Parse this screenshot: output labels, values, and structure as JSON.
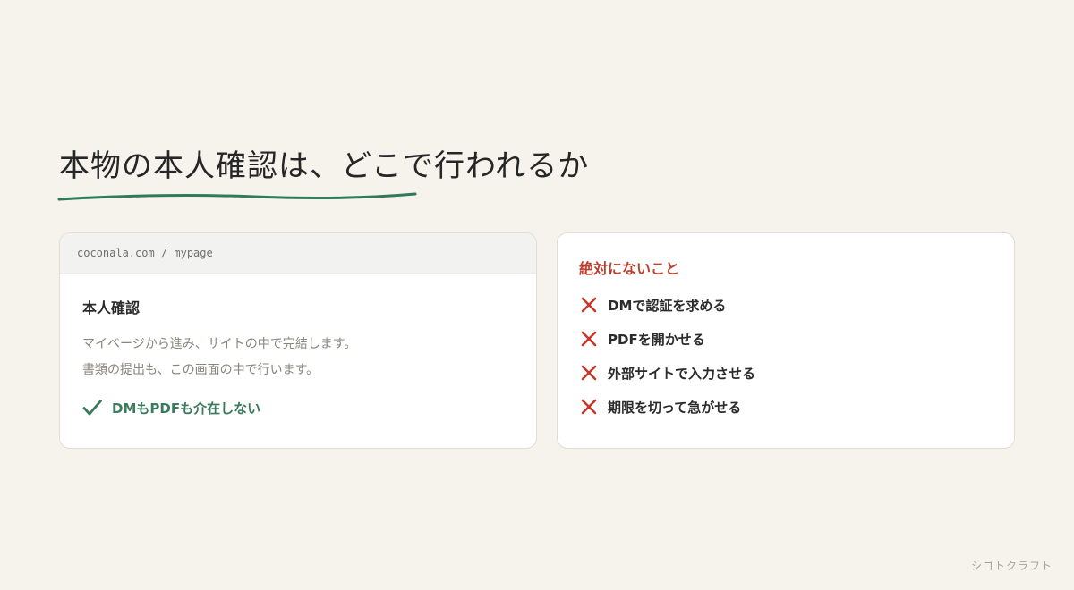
{
  "heading": {
    "title": "本物の本人確認は、どこで行われるか"
  },
  "legit_card": {
    "url": "coconala.com / mypage",
    "title": "本人確認",
    "lines": [
      "マイページから進み、サイトの中で完結します。",
      "書類の提出も、この画面の中で行います。"
    ],
    "check_text": "DMもPDFも介在しない",
    "check_icon": "check-icon"
  },
  "never_card": {
    "title": "絶対にないこと",
    "items": [
      "DMで認証を求める",
      "PDFを開かせる",
      "外部サイトで入力させる",
      "期限を切って急がせる"
    ],
    "item_icon": "cross-icon"
  },
  "watermark": "シゴトクラフト",
  "colors": {
    "background": "#f6f3ed",
    "accent_green": "#3a7a5e",
    "accent_red": "#b8412f",
    "card_border": "#e0ddd6"
  }
}
